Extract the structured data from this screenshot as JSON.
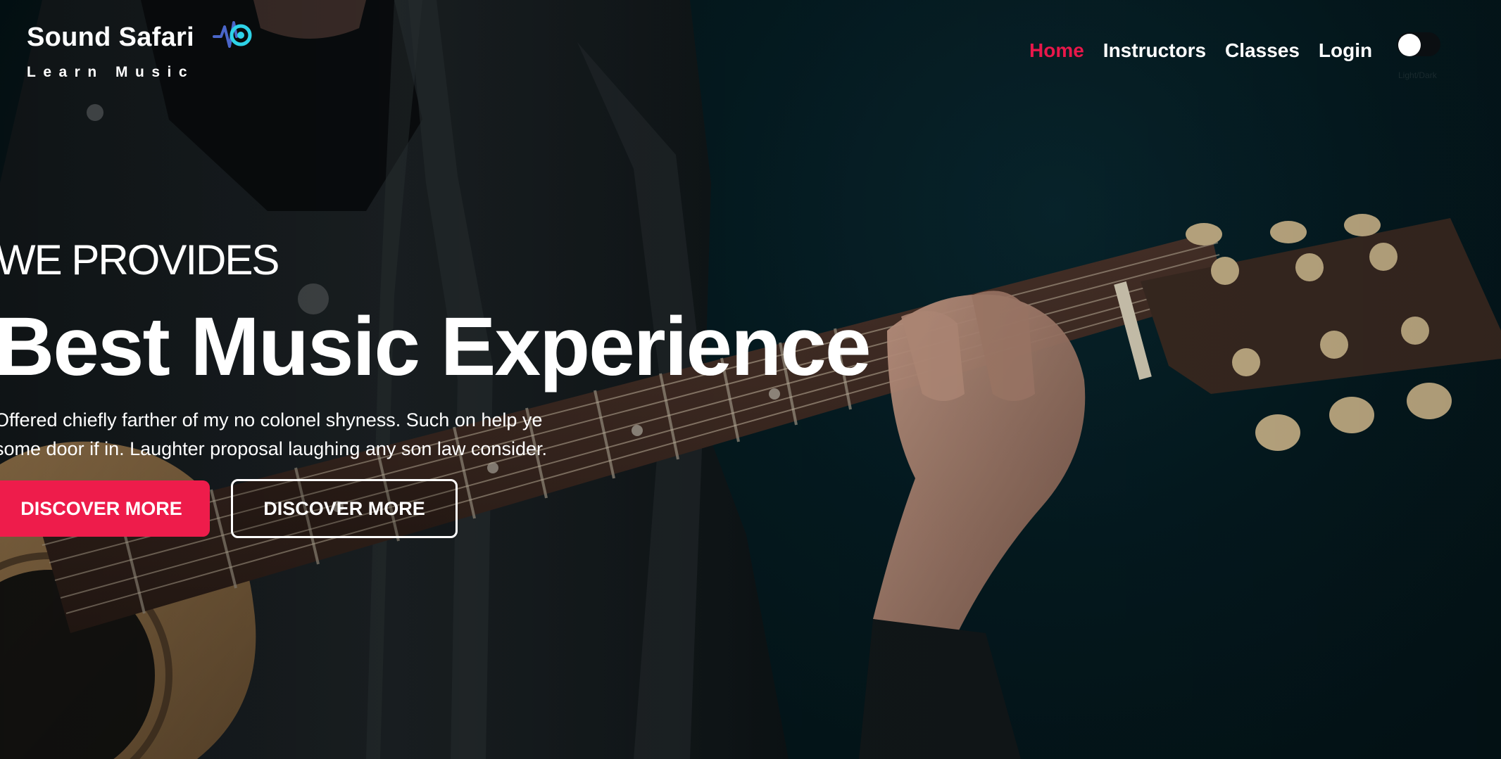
{
  "brand": {
    "name": "Sound Safari",
    "tagline": "Learn Music",
    "logo_icon": "music-wave-logo-icon",
    "colors": {
      "logo_blue": "#4a66c9",
      "logo_cyan": "#2ed3e8"
    }
  },
  "nav": {
    "items": [
      {
        "label": "Home",
        "active": true
      },
      {
        "label": "Instructors",
        "active": false
      },
      {
        "label": "Classes",
        "active": false
      },
      {
        "label": "Login",
        "active": false
      }
    ],
    "theme_toggle_label": "Light/Dark"
  },
  "hero": {
    "eyebrow": "WE PROVIDES",
    "headline": "Best Music Experience",
    "lead_line1": "Offered chiefly farther of my no colonel shyness. Such on help ye",
    "lead_line2": "some door if in. Laughter proposal laughing any son law consider.",
    "primary_button": "DISCOVER MORE",
    "secondary_button": "DISCOVER MORE"
  },
  "colors": {
    "accent": "#ee1c4b",
    "nav_active": "#e8174a",
    "text": "#ffffff",
    "background": "#06171c"
  }
}
